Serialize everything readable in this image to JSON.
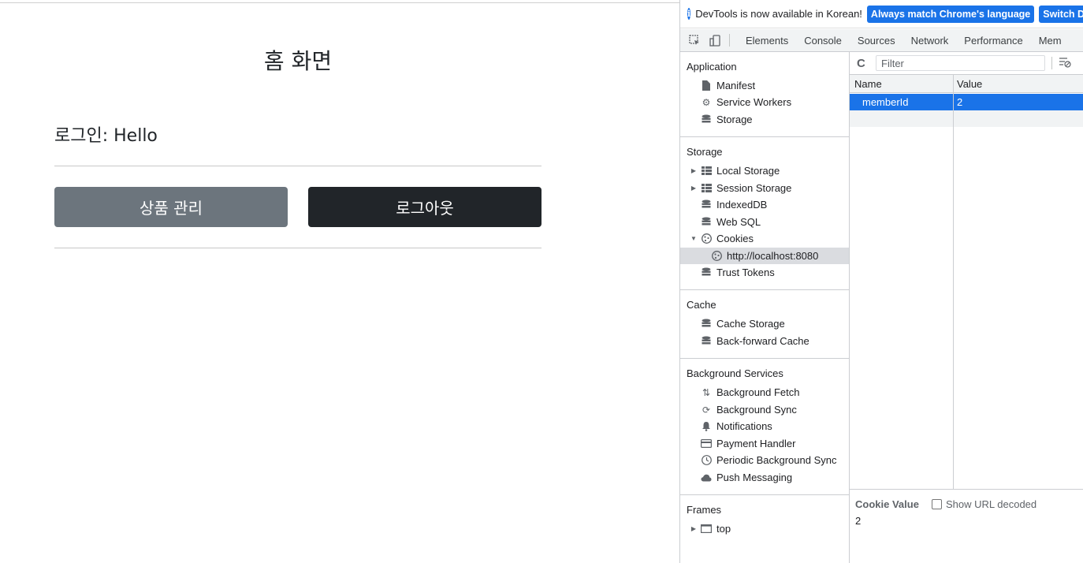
{
  "page": {
    "title": "홈 화면",
    "login_text": "로그인: Hello",
    "buttons": {
      "manage": "상품 관리",
      "logout": "로그아웃"
    }
  },
  "devtools": {
    "infobar": {
      "message": "DevTools is now available in Korean!",
      "btn_match": "Always match Chrome's language",
      "btn_switch": "Switch D"
    },
    "tabs": [
      "Elements",
      "Console",
      "Sources",
      "Network",
      "Performance",
      "Mem"
    ],
    "sidebar": {
      "application": {
        "title": "Application",
        "items": [
          "Manifest",
          "Service Workers",
          "Storage"
        ]
      },
      "storage": {
        "title": "Storage",
        "items": [
          "Local Storage",
          "Session Storage",
          "IndexedDB",
          "Web SQL",
          "Cookies",
          "http://localhost:8080",
          "Trust Tokens"
        ]
      },
      "cache": {
        "title": "Cache",
        "items": [
          "Cache Storage",
          "Back-forward Cache"
        ]
      },
      "background": {
        "title": "Background Services",
        "items": [
          "Background Fetch",
          "Background Sync",
          "Notifications",
          "Payment Handler",
          "Periodic Background Sync",
          "Push Messaging"
        ]
      },
      "frames": {
        "title": "Frames",
        "items": [
          "top"
        ]
      }
    },
    "filter_placeholder": "Filter",
    "table": {
      "headers": {
        "name": "Name",
        "value": "Value"
      },
      "rows": [
        {
          "name": "memberId",
          "value": "2"
        }
      ]
    },
    "cookie_value": {
      "label": "Cookie Value",
      "checkbox": "Show URL decoded",
      "value": "2"
    }
  }
}
